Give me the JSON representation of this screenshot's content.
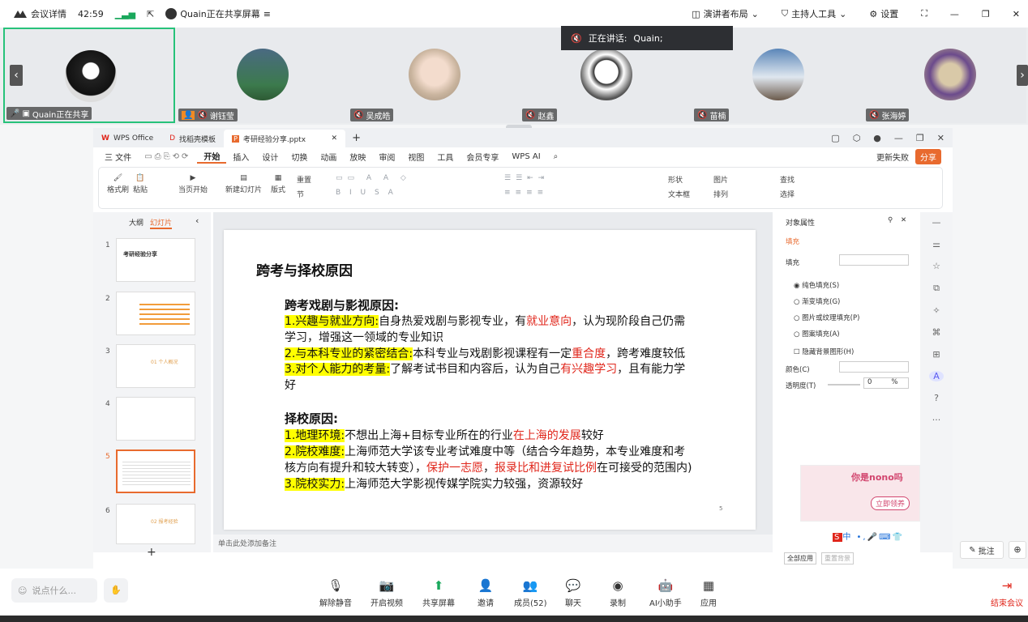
{
  "topbar": {
    "meeting_details": "会议详情",
    "timer": "42:59",
    "sharing": "Quain正在共享屏幕",
    "presenter_layout": "演讲者布局",
    "host_tools": "主持人工具",
    "settings": "设置"
  },
  "participants": [
    {
      "name": "Quain正在共享"
    },
    {
      "name": "谢钰莹"
    },
    {
      "name": "吴成皓"
    },
    {
      "name": "赵鑫"
    },
    {
      "name": "苗楠"
    },
    {
      "name": "张海婷"
    }
  ],
  "speaking": {
    "label": "正在讲话:",
    "name": "Quain;"
  },
  "wps": {
    "tabs": [
      {
        "label": "WPS Office"
      },
      {
        "label": "找稻壳模板"
      },
      {
        "label": "考研经验分享.pptx"
      }
    ],
    "menus": [
      "三 文件",
      "开始",
      "插入",
      "设计",
      "切换",
      "动画",
      "放映",
      "审阅",
      "视图",
      "工具",
      "会员专享",
      "WPS AI"
    ],
    "update_fail": "更新失败",
    "share": "分享",
    "ribbon": {
      "format_painter": "格式刷",
      "paste": "粘贴",
      "from_current": "当页开始",
      "new_slide": "新建幻灯片",
      "layout": "版式",
      "reset": "重置",
      "section": "节",
      "shape": "形状",
      "picture": "图片",
      "textbox": "文本框",
      "arrange": "排列",
      "find": "查找",
      "select": "选择"
    },
    "left_tabs": {
      "outline": "大纲",
      "slides": "幻灯片"
    },
    "thumbs": [
      {
        "n": "1",
        "t": "考研经验分享"
      },
      {
        "n": "2",
        "t": ""
      },
      {
        "n": "3",
        "t": "01 个人概况"
      },
      {
        "n": "4",
        "t": ""
      },
      {
        "n": "5",
        "t": ""
      },
      {
        "n": "6",
        "t": "02 报考经验"
      }
    ],
    "notes": "单击此处添加备注",
    "slide": {
      "title": "跨考与择校原因",
      "h1": "跨考戏剧与影视原因:",
      "p1a": "1.兴趣与就业方向:",
      "p1b": "自身热爱戏剧与影视专业，有",
      "p1c": "就业意向",
      "p1d": "，认为现阶段自己仍需",
      "p1e": "学习，增强这一领域的专业知识",
      "p2a": "2.与本科专业的紧密结合:",
      "p2b": "本科专业与戏剧影视课程有一定",
      "p2c": "重合度",
      "p2d": "，跨考难度较低",
      "p3a": "3.对个人能力的考量:",
      "p3b": "了解考试书目和内容后，认为自己",
      "p3c": "有兴趣学习",
      "p3d": "，且有能力学",
      "p3e": "好",
      "h2": "择校原因:",
      "q1a": "1.地理环境:",
      "q1b": "不想出上海+目标专业所在的行业",
      "q1c": "在上海的发展",
      "q1d": "较好",
      "q2a": "2.院校难度:",
      "q2b": "上海师范大学该专业考试难度中等（结合今年趋势，本专业难度和考",
      "q2c": "核方向有提升和较大转变），",
      "q2d": "保护一志愿",
      "q2e": "，",
      "q2f": "报录比和进复试比例",
      "q2g": "在可接受的范围内)",
      "q3a": "3.院校实力:",
      "q3b": "上海师范大学影视传媒学院实力较强，资源较好",
      "page": "5"
    },
    "props": {
      "title": "对象属性",
      "fill_tab": "填充",
      "fill": "填充",
      "solid": "纯色填充(S)",
      "gradient": "渐变填充(G)",
      "picture_fill": "图片或纹理填充(P)",
      "pattern": "图案填充(A)",
      "hide_bg": "隐藏背景图形(H)",
      "color": "颜色(C)",
      "transparency": "透明度(T)",
      "trans_value": "0",
      "trans_unit": "%",
      "apply_all": "全部应用",
      "reset_bg": "重置背景"
    },
    "ad": {
      "title": "你是nono吗",
      "btn": "立即领养"
    }
  },
  "floating": {
    "annotate": "批注"
  },
  "bottom": {
    "chat_placeholder": "说点什么...",
    "unmute": "解除静音",
    "video": "开启视频",
    "share": "共享屏幕",
    "invite": "邀请",
    "members": "成员(52)",
    "chat": "聊天",
    "record": "录制",
    "ai": "AI小助手",
    "apps": "应用",
    "end": "结束会议"
  },
  "colors": {
    "accent": "#e86a2e",
    "highlight": "#ffff00",
    "red": "#e0261b",
    "end": "#e0261b"
  }
}
